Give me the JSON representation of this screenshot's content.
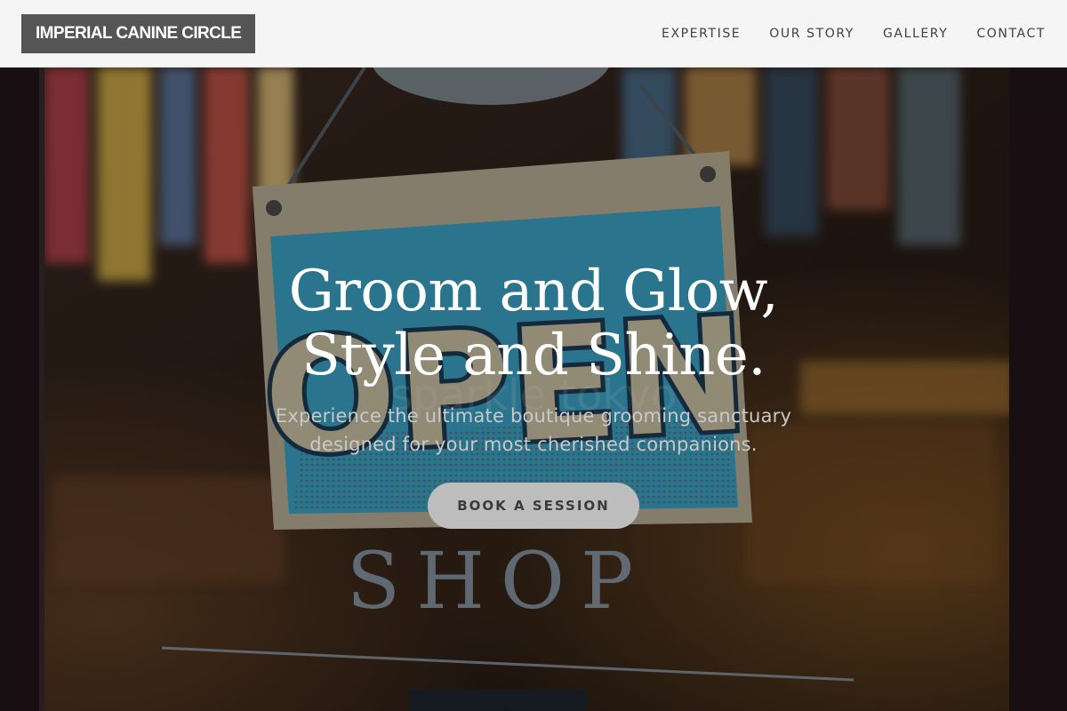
{
  "header": {
    "brand": "IMPERIAL CANINE CIRCLE",
    "nav": [
      {
        "label": "EXPERTISE"
      },
      {
        "label": "OUR STORY"
      },
      {
        "label": "GALLERY"
      },
      {
        "label": "CONTACT"
      }
    ]
  },
  "hero": {
    "headline_line1": "Groom and Glow,",
    "headline_line2": "Style and Shine.",
    "subtitle_line1": "Experience the ultimate boutique grooming sanctuary",
    "subtitle_line2": "designed for your most cherished companions.",
    "cta_label": "BOOK A SESSION",
    "photo": {
      "sign_text": "OPEN",
      "window_text": "SHOP",
      "faded_text": "sparkle tokyo"
    }
  },
  "colors": {
    "header_bg": "#f5f5f5",
    "brand_bg": "#555555",
    "sign_blue": "#3ba3c4",
    "cta_bg": "#bdbdbd"
  }
}
